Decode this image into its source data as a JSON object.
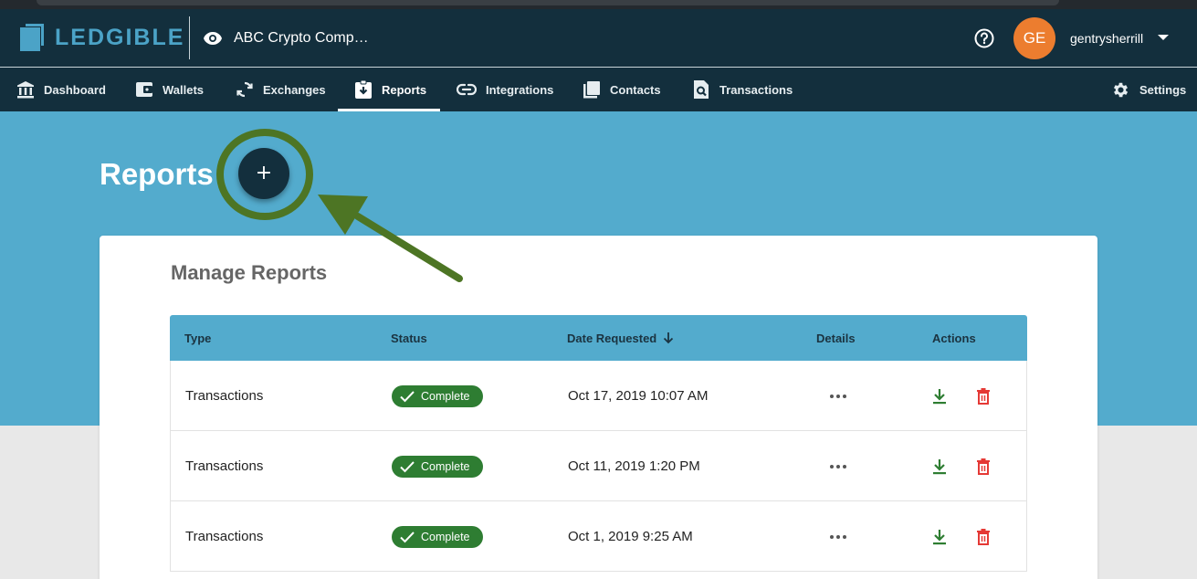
{
  "app": {
    "logo_text": "LEDGIBLE",
    "company_name": "ABC Crypto Comp…"
  },
  "user": {
    "initials": "GE",
    "name": "gentrysherrill"
  },
  "nav": {
    "items": [
      {
        "label": "Dashboard",
        "icon": "bank-icon"
      },
      {
        "label": "Wallets",
        "icon": "wallet-icon"
      },
      {
        "label": "Exchanges",
        "icon": "sync-icon"
      },
      {
        "label": "Reports",
        "icon": "clipboard-download-icon",
        "active": true
      },
      {
        "label": "Integrations",
        "icon": "link-icon"
      },
      {
        "label": "Contacts",
        "icon": "contacts-icon"
      },
      {
        "label": "Transactions",
        "icon": "document-search-icon"
      }
    ],
    "settings_label": "Settings"
  },
  "page": {
    "title": "Reports",
    "fab_icon": "+"
  },
  "card": {
    "title": "Manage Reports"
  },
  "table": {
    "headers": {
      "type": "Type",
      "status": "Status",
      "date": "Date Requested",
      "details": "Details",
      "actions": "Actions"
    },
    "rows": [
      {
        "type": "Transactions",
        "status": "Complete",
        "date": "Oct 17, 2019 10:07 AM"
      },
      {
        "type": "Transactions",
        "status": "Complete",
        "date": "Oct 11, 2019 1:20 PM"
      },
      {
        "type": "Transactions",
        "status": "Complete",
        "date": "Oct 1, 2019 9:25 AM"
      }
    ]
  },
  "colors": {
    "header_bg": "#132f3d",
    "hero_bg": "#53abcd",
    "accent": "#4ba3c7",
    "avatar": "#ec7d2f",
    "success": "#2e7d32",
    "danger": "#e53935",
    "annotation": "#4d7524"
  }
}
